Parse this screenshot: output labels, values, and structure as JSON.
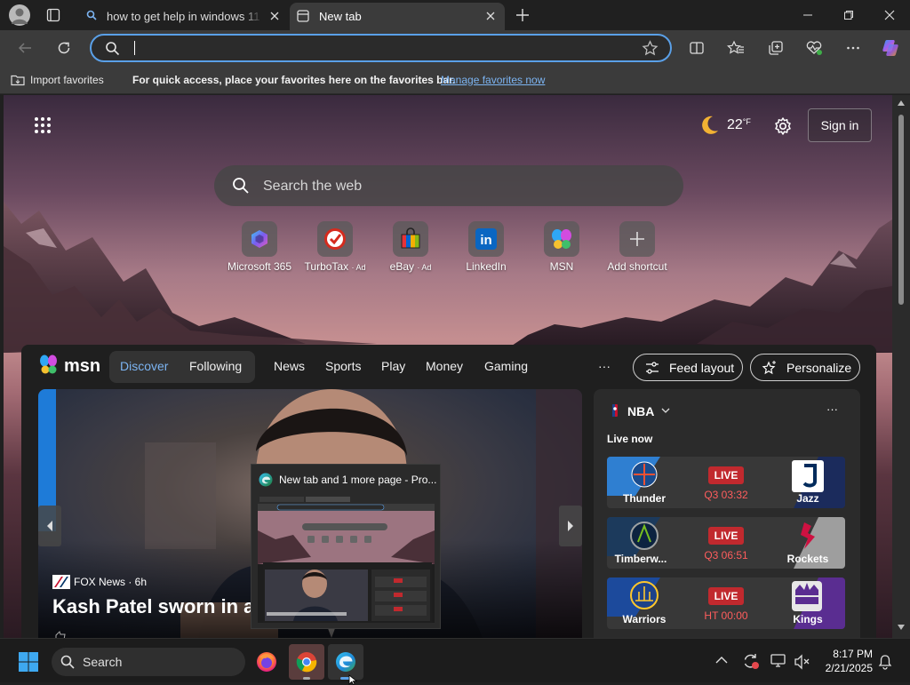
{
  "browser": {
    "tabs": [
      {
        "title": "how to get help in windows 11 - B"
      },
      {
        "title": "New tab"
      }
    ],
    "address_value": ""
  },
  "favorites_bar": {
    "import_label": "Import favorites",
    "hint": "For quick access, place your favorites here on the favorites bar.",
    "manage_link": "Manage favorites now"
  },
  "ntp": {
    "weather_temp": "22",
    "weather_unit": "°F",
    "sign_in": "Sign in",
    "search_placeholder": "Search the web",
    "shortcuts": [
      {
        "label": "Microsoft 365",
        "ad": ""
      },
      {
        "label": "TurboTax",
        "ad": "· Ad"
      },
      {
        "label": "eBay",
        "ad": "· Ad"
      },
      {
        "label": "LinkedIn",
        "ad": ""
      },
      {
        "label": "MSN",
        "ad": ""
      },
      {
        "label": "Add shortcut",
        "ad": ""
      }
    ]
  },
  "feed": {
    "brand": "msn",
    "tabs": [
      "Discover",
      "Following"
    ],
    "nav": [
      "News",
      "Sports",
      "Play",
      "Money",
      "Gaming"
    ],
    "more": "···",
    "feed_layout": "Feed layout",
    "personalize": "Personalize",
    "hero": {
      "source": "FOX News · 6h",
      "headline": "Kash Patel sworn in a"
    },
    "nba": {
      "title": "NBA",
      "live_now": "Live now",
      "more": "···",
      "games": [
        {
          "home": "Thunder",
          "away": "Jazz",
          "status": "LIVE",
          "clock": "Q3 03:32",
          "home_color": "#2f7fd1",
          "away_color": "#1b2b5c"
        },
        {
          "home": "Timberw...",
          "away": "Rockets",
          "status": "LIVE",
          "clock": "Q3 06:51",
          "home_color": "#1c3a5c",
          "away_color": "#9e9e9e"
        },
        {
          "home": "Warriors",
          "away": "Kings",
          "status": "LIVE",
          "clock": "HT 00:00",
          "home_color": "#1c4a9c",
          "away_color": "#5a2d91"
        }
      ]
    }
  },
  "taskbar": {
    "search_label": "Search",
    "time": "8:17 PM",
    "date": "2/21/2025",
    "preview_title": "New tab and 1 more page - Pro..."
  }
}
